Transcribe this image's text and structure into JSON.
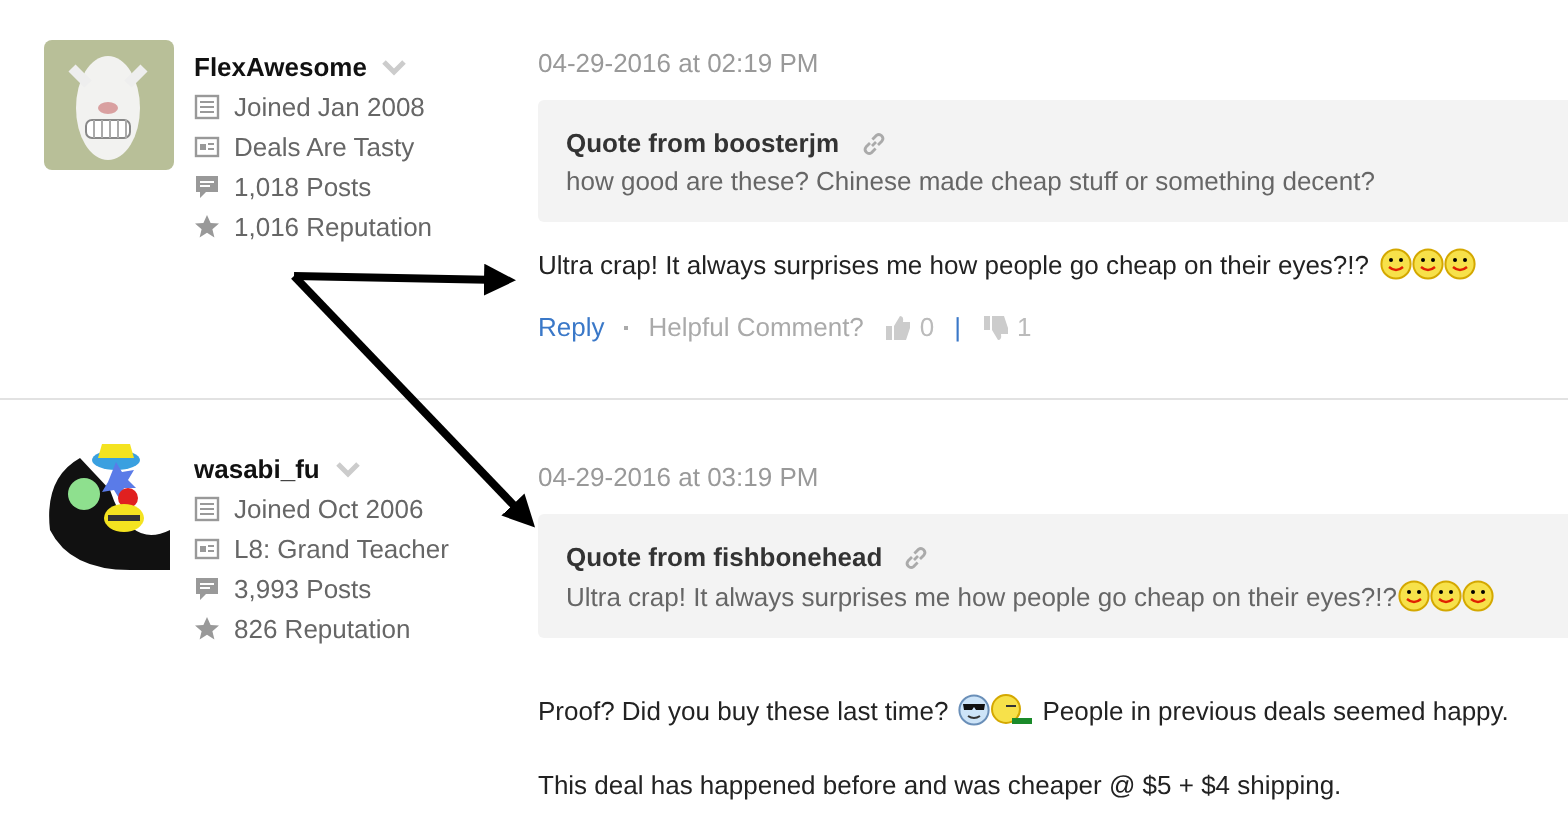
{
  "posts": [
    {
      "user": {
        "name": "FlexAwesome",
        "avatar": {
          "kind": "goat"
        },
        "joined": "Joined Jan 2008",
        "title": "Deals Are Tasty",
        "posts": "1,018 Posts",
        "reputation": "1,016 Reputation"
      },
      "date": "04-29-2016 at 02:19 PM",
      "quote": {
        "author": "Quote from boosterjm",
        "body": [
          {
            "kind": "text",
            "text": "how good are these? Chinese made cheap stuff or something decent?"
          }
        ]
      },
      "paragraphs": [
        [
          {
            "kind": "text",
            "text": "Ultra crap! It always surprises me how people go cheap on their eyes?!?"
          },
          {
            "kind": "smiley"
          },
          {
            "kind": "smiley"
          },
          {
            "kind": "smiley"
          }
        ]
      ],
      "actions": {
        "reply": "Reply",
        "helpful": "Helpful Comment?",
        "up": "0",
        "separator": "|",
        "down": "1"
      }
    },
    {
      "user": {
        "name": "wasabi_fu",
        "avatar": {
          "kind": "clown"
        },
        "joined": "Joined Oct 2006",
        "title": "L8: Grand Teacher",
        "posts": "3,993 Posts",
        "reputation": "826 Reputation"
      },
      "date": "04-29-2016 at 03:19 PM",
      "quote": {
        "author": "Quote from fishbonehead",
        "body": [
          {
            "kind": "text",
            "text": "Ultra crap! It always surprises me how people go cheap on their eyes?!?"
          },
          {
            "kind": "smiley"
          },
          {
            "kind": "smiley"
          },
          {
            "kind": "smiley"
          }
        ]
      },
      "paragraphs": [
        [
          {
            "kind": "text",
            "text": "Proof? Did you buy these last time?"
          },
          {
            "kind": "cool"
          },
          {
            "kind": "sleepy"
          },
          {
            "kind": "text",
            "text": "People in previous deals seemed happy."
          }
        ],
        [
          {
            "kind": "text",
            "text": "This deal has happened before and was cheaper @ $5 + $4 shipping."
          }
        ]
      ]
    }
  ]
}
